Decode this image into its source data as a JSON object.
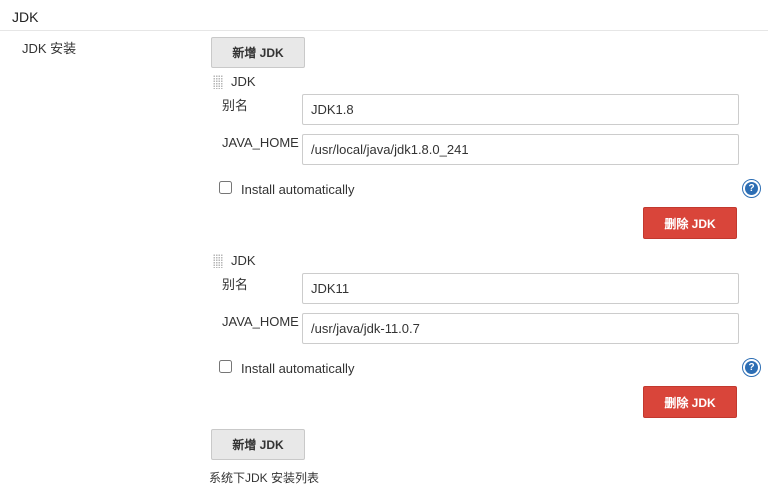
{
  "section": {
    "title": "JDK"
  },
  "row_label": "JDK 安装",
  "add_button_label": "新增 JDK",
  "installations": [
    {
      "header": "JDK",
      "alias_label": "别名",
      "alias_value": "JDK1.8",
      "java_home_label": "JAVA_HOME",
      "java_home_value": "/usr/local/java/jdk1.8.0_241",
      "install_auto_label": "Install automatically",
      "install_auto_checked": false,
      "delete_label": "删除 JDK",
      "help_icon": "help-icon"
    },
    {
      "header": "JDK",
      "alias_label": "别名",
      "alias_value": "JDK11",
      "java_home_label": "JAVA_HOME",
      "java_home_value": "/usr/java/jdk-11.0.7",
      "install_auto_label": "Install automatically",
      "install_auto_checked": false,
      "delete_label": "删除 JDK",
      "help_icon": "help-icon"
    }
  ],
  "footer_description": "系统下JDK 安装列表",
  "colors": {
    "delete_button": "#d9453a",
    "help_icon": "#2d6eb4",
    "gray_button": "#e8e8e8"
  }
}
